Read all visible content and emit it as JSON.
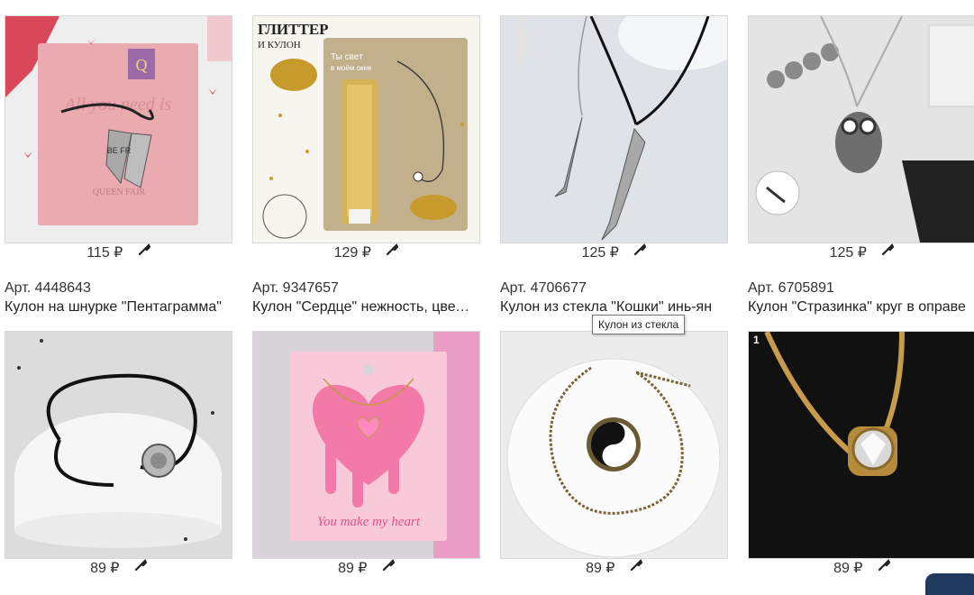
{
  "rows": [
    [
      {
        "price": "115 ₽"
      },
      {
        "price": "129 ₽",
        "image_text": [
          "ГЛИТТЕР",
          "И КУЛОН",
          "Ты свет",
          "в моём окне"
        ]
      },
      {
        "price": "125 ₽"
      },
      {
        "price": "125 ₽"
      }
    ],
    [
      {
        "price": "89 ₽",
        "art": "Арт. 4448643",
        "title": "Кулон на шнурке \"Пентаграмма\""
      },
      {
        "price": "89 ₽",
        "art": "Арт. 9347657",
        "title": "Кулон \"Сердце\" нежность, цвет розовый"
      },
      {
        "price": "89 ₽",
        "art": "Арт. 4706677",
        "title": "Кулон из стекла \"Кошки\" инь-ян"
      },
      {
        "price": "89 ₽",
        "art": "Арт. 6705891",
        "title": "Кулон \"Стразинка\" круг в оправе",
        "badge": "1"
      }
    ]
  ],
  "images": {
    "card1_brand": "QUEEN FAIR",
    "card1_script": "All you need is",
    "card1_logo": "Q",
    "card1_pendant": "BE FR",
    "card6_script": "You make my heart"
  },
  "tooltip": "Кулон из стекла",
  "icons": {
    "price_action": "wrench-icon"
  },
  "colors": {
    "border": "#d8d8d8",
    "text": "#222222",
    "tooltip_border": "#767676"
  }
}
